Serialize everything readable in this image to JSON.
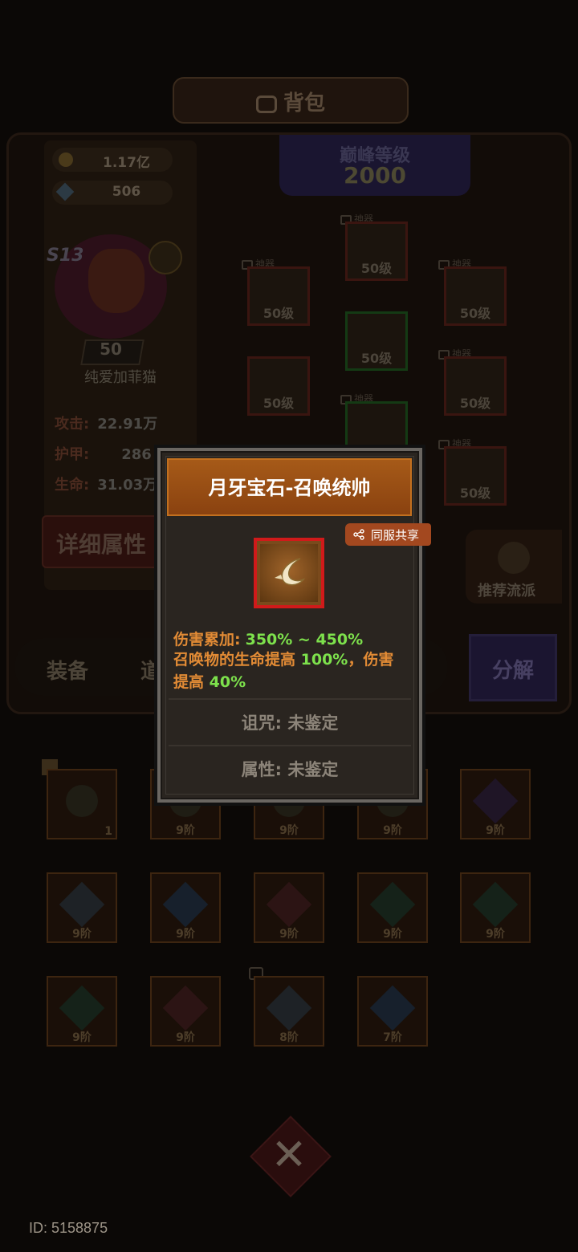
{
  "header": {
    "title": "背包"
  },
  "resources": {
    "gold": "1.17亿",
    "gems": "506"
  },
  "player": {
    "season": "S13",
    "level": "50",
    "name": "纯爱加菲猫",
    "stats": [
      {
        "label": "攻击:",
        "value": "22.91万"
      },
      {
        "label": "护甲:",
        "value": "286"
      },
      {
        "label": "生命:",
        "value": "31.03万"
      }
    ],
    "detail_button": "详细属性"
  },
  "peak": {
    "title": "巅峰等级",
    "value": "2000"
  },
  "equipment": {
    "tag": "神器",
    "slot_level": "50级"
  },
  "recommend": {
    "label": "推荐流派"
  },
  "tabs": {
    "equip": "装备",
    "items": "道",
    "split": "分解"
  },
  "inventory": {
    "row1": [
      "1",
      "9阶",
      "9阶",
      "9阶",
      "9阶"
    ],
    "row2": [
      "9阶",
      "9阶",
      "9阶",
      "9阶",
      "9阶"
    ],
    "row3": [
      "9阶",
      "9阶",
      "8阶",
      "7阶"
    ]
  },
  "popup": {
    "title": "月牙宝石-召唤统帅",
    "share_label": "同服共享",
    "damage_label": "伤害累加:",
    "damage_value": "350% ~ 450%",
    "effect_prefix": "召唤物的生命提高",
    "effect_hp": "100%",
    "effect_mid": "，伤害提高",
    "effect_dmg": "40%",
    "curse": "诅咒: 未鉴定",
    "attribute": "属性: 未鉴定"
  },
  "footer": {
    "user_id": "ID: 5158875"
  },
  "colors": {
    "title_bg": "#a65a18",
    "accent_orange": "#e28b35",
    "accent_green": "#7de14c",
    "item_border": "#d01a1a"
  }
}
